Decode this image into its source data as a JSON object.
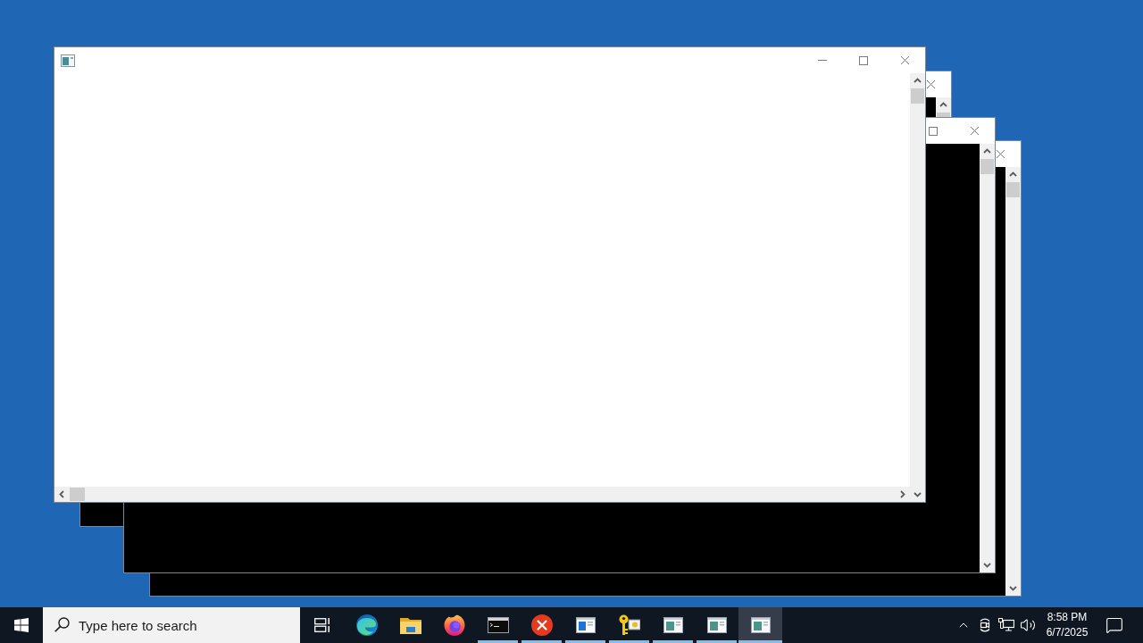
{
  "desktop": {
    "windows": [
      {
        "kind": "blank"
      },
      {
        "kind": "console"
      },
      {
        "kind": "console"
      },
      {
        "kind": "console"
      }
    ]
  },
  "taskbar": {
    "search": {
      "placeholder": "Type here to search"
    },
    "apps": [
      {
        "kind": "swirl-browser",
        "running": false,
        "selected": false
      },
      {
        "kind": "folder",
        "running": false,
        "selected": false
      },
      {
        "kind": "flame-browser",
        "running": false,
        "selected": false
      },
      {
        "kind": "console",
        "running": true,
        "selected": false
      },
      {
        "kind": "error",
        "running": true,
        "selected": false
      },
      {
        "kind": "blue-window",
        "running": true,
        "selected": false
      },
      {
        "kind": "keys",
        "running": true,
        "selected": false
      },
      {
        "kind": "window",
        "running": true,
        "selected": false
      },
      {
        "kind": "window",
        "running": true,
        "selected": false
      },
      {
        "kind": "window",
        "running": true,
        "selected": true
      }
    ],
    "tray": {
      "time": "8:58 PM",
      "date": "6/7/2025"
    }
  }
}
